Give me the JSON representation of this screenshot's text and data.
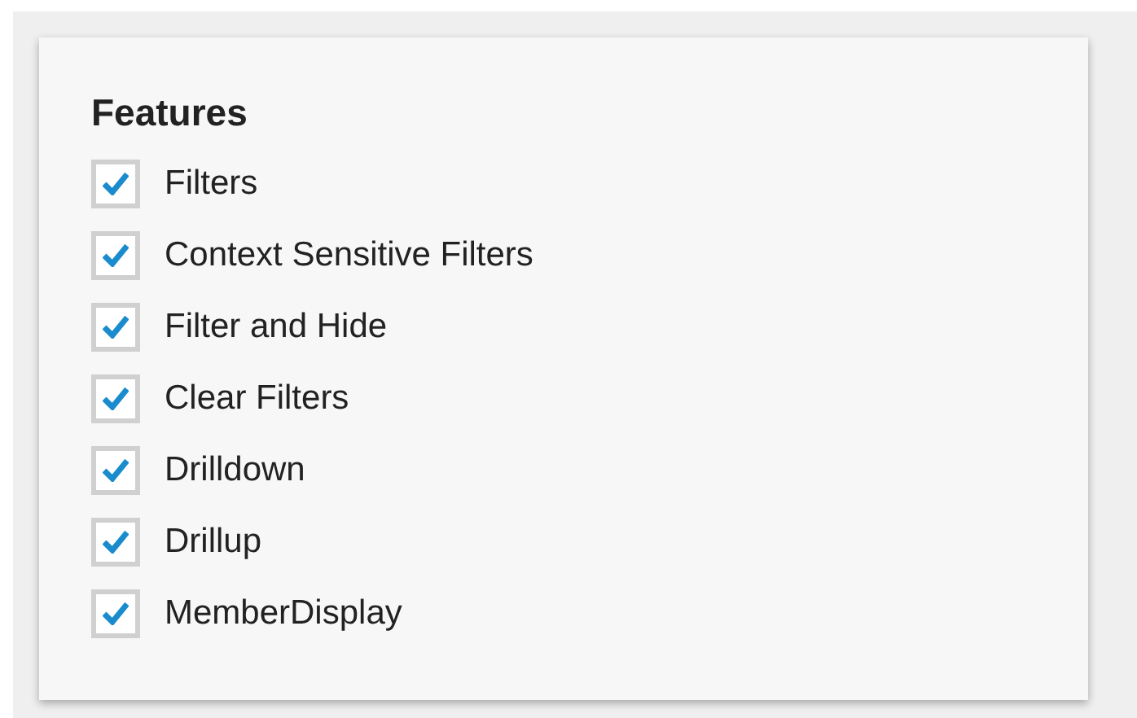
{
  "panel": {
    "title": "Features",
    "items": [
      {
        "label": "Filters",
        "checked": true
      },
      {
        "label": "Context Sensitive Filters",
        "checked": true
      },
      {
        "label": "Filter and Hide",
        "checked": true
      },
      {
        "label": "Clear Filters",
        "checked": true
      },
      {
        "label": "Drilldown",
        "checked": true
      },
      {
        "label": "Drillup",
        "checked": true
      },
      {
        "label": "MemberDisplay",
        "checked": true
      }
    ]
  }
}
